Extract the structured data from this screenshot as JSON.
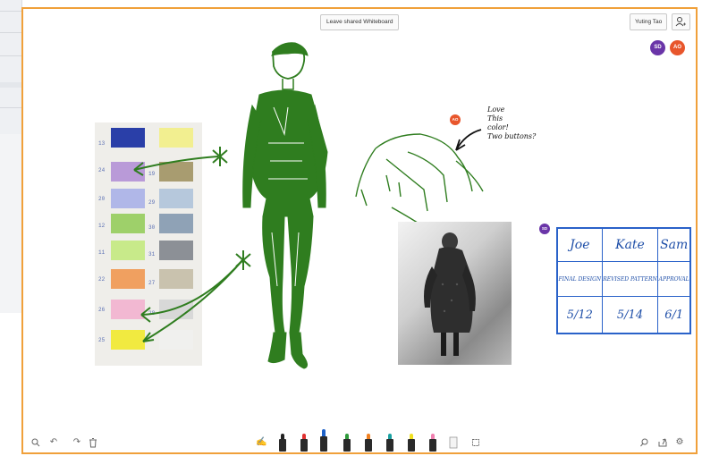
{
  "whiteboard": {
    "leave_label": "Leave shared Whiteboard",
    "user_name": "Yuting Tao",
    "people_icon": "person-icon",
    "avatars": [
      {
        "initials": "SD",
        "color": "#6a35a8"
      },
      {
        "initials": "AO",
        "color": "#e8562c"
      }
    ],
    "cursors": [
      {
        "initials": "AO",
        "color": "#e8562c"
      },
      {
        "initials": "SD",
        "color": "#6a35a8"
      }
    ],
    "frame_color": "#f0a03a"
  },
  "swatch_numbers": [
    "13",
    "24",
    "20",
    "12",
    "11",
    "22",
    "26",
    "25",
    "19",
    "29",
    "30",
    "31",
    "27",
    "28"
  ],
  "note": {
    "lines": [
      "Love",
      "This",
      "color!",
      "Two buttons?"
    ]
  },
  "schedule_table": {
    "headers": [
      "Joe",
      "Kate",
      "Sam"
    ],
    "tasks": [
      "FINAL DESIGN",
      "REVISED PATTERN",
      "APPROVAL"
    ],
    "dates": [
      "5/12",
      "5/14",
      "6/1"
    ],
    "color": "#2a62c9"
  },
  "toolbar": {
    "left_icons": [
      "zoom-icon",
      "undo-icon",
      "redo-icon",
      "trash-icon"
    ],
    "pens": [
      {
        "name": "black-pen",
        "color": "#222222"
      },
      {
        "name": "red-pen",
        "color": "#e03030"
      },
      {
        "name": "blue-pen",
        "color": "#1e62c8"
      },
      {
        "name": "green-pen",
        "color": "#2e9a3a"
      },
      {
        "name": "orange-pen",
        "color": "#f08020"
      },
      {
        "name": "teal-pen",
        "color": "#1aa0a0"
      },
      {
        "name": "yellow-highlighter",
        "color": "#f0e020"
      },
      {
        "name": "pink-highlighter",
        "color": "#f080b0"
      }
    ],
    "right_icons": [
      "search-icon",
      "share-icon",
      "settings-icon"
    ]
  }
}
